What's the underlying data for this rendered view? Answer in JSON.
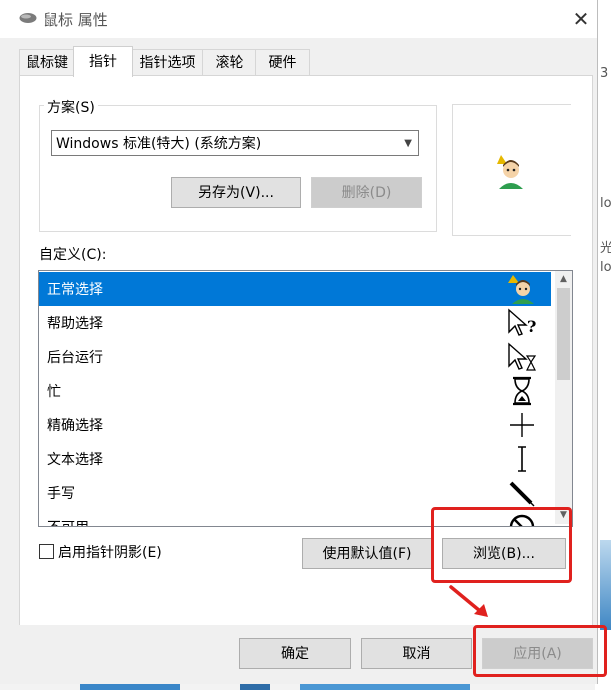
{
  "window": {
    "title": "鼠标 属性",
    "close_glyph": "✕"
  },
  "tabs": [
    {
      "label": "鼠标键"
    },
    {
      "label": "指针",
      "active": true
    },
    {
      "label": "指针选项"
    },
    {
      "label": "滚轮"
    },
    {
      "label": "硬件"
    }
  ],
  "scheme": {
    "label": "方案(S)",
    "selected": "Windows 标准(特大) (系统方案)",
    "save_as_label": "另存为(V)...",
    "delete_label": "删除(D)"
  },
  "customize": {
    "label": "自定义(C):",
    "items": [
      {
        "label": "正常选择",
        "icon": "character-cursor-icon",
        "selected": true
      },
      {
        "label": "帮助选择",
        "icon": "help-arrow-icon"
      },
      {
        "label": "后台运行",
        "icon": "working-in-background-icon"
      },
      {
        "label": "忙",
        "icon": "hourglass-icon"
      },
      {
        "label": "精确选择",
        "icon": "crosshair-icon"
      },
      {
        "label": "文本选择",
        "icon": "text-ibeam-icon"
      },
      {
        "label": "手写",
        "icon": "pen-icon"
      },
      {
        "label": "不可用",
        "icon": "unavailable-icon"
      }
    ]
  },
  "shadow": {
    "label": "启用指针阴影(E)",
    "checked": false
  },
  "use_default_label": "使用默认值(F)",
  "browse_label": "浏览(B)...",
  "footer": {
    "ok_label": "确定",
    "cancel_label": "取消",
    "apply_label": "应用(A)"
  },
  "background_glyphs": [
    "3",
    "lo",
    "光",
    "lo"
  ],
  "colors": {
    "accent": "#0078d7",
    "annotation": "#e0211e"
  }
}
